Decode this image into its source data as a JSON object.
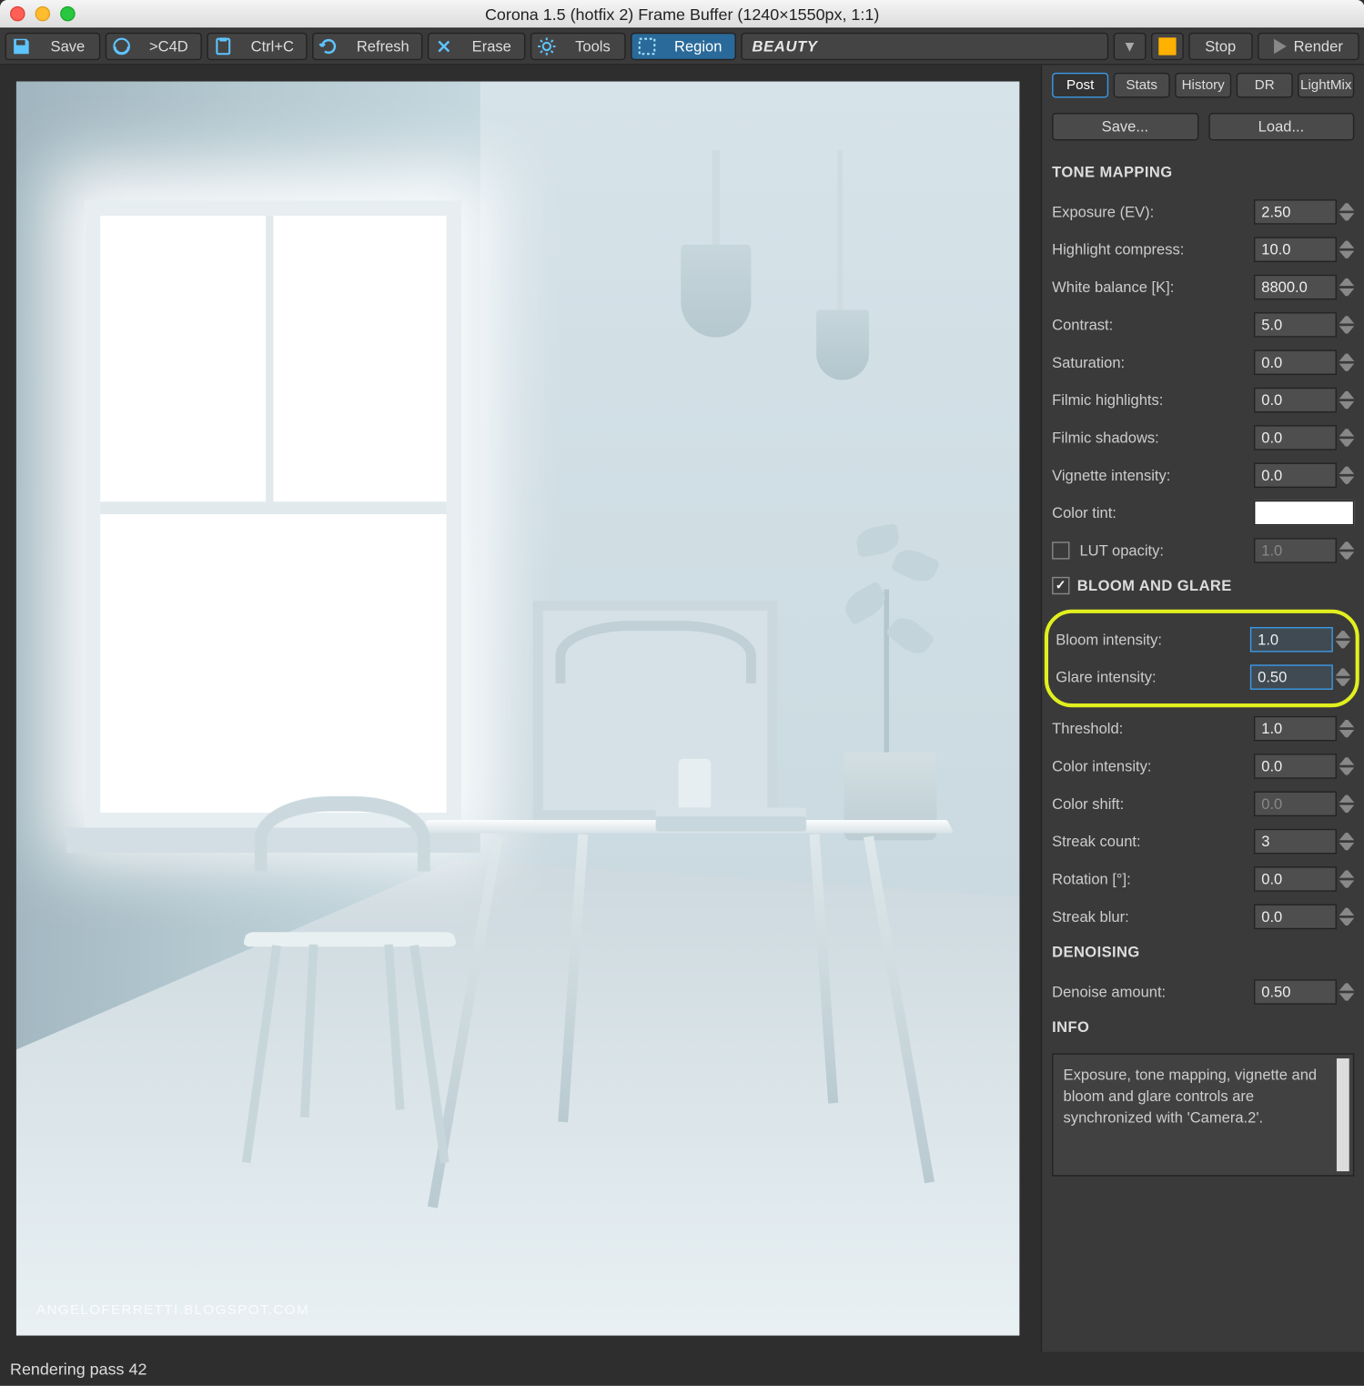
{
  "title": "Corona 1.5 (hotfix 2) Frame Buffer (1240×1550px, 1:1)",
  "toolbar": {
    "save": "Save",
    "c4d": ">C4D",
    "ctrlc": "Ctrl+C",
    "refresh": "Refresh",
    "erase": "Erase",
    "tools": "Tools",
    "region": "Region",
    "pass": "BEAUTY",
    "stop": "Stop",
    "render": "Render"
  },
  "tabs": [
    "Post",
    "Stats",
    "History",
    "DR",
    "LightMix"
  ],
  "active_tab": 0,
  "post": {
    "save_btn": "Save...",
    "load_btn": "Load...",
    "sections": {
      "tone": "TONE MAPPING",
      "bloom": "BLOOM AND GLARE",
      "denoise": "DENOISING",
      "info": "INFO"
    },
    "tone": {
      "exposure": {
        "label": "Exposure (EV):",
        "value": "2.50"
      },
      "highlight": {
        "label": "Highlight compress:",
        "value": "10.0"
      },
      "whitebal": {
        "label": "White balance [K]:",
        "value": "8800.0"
      },
      "contrast": {
        "label": "Contrast:",
        "value": "5.0"
      },
      "saturation": {
        "label": "Saturation:",
        "value": "0.0"
      },
      "filmic_hi": {
        "label": "Filmic highlights:",
        "value": "0.0"
      },
      "filmic_sh": {
        "label": "Filmic shadows:",
        "value": "0.0"
      },
      "vignette": {
        "label": "Vignette intensity:",
        "value": "0.0"
      },
      "tint": {
        "label": "Color tint:",
        "value": "#ffffff"
      },
      "lut": {
        "label": "LUT opacity:",
        "value": "1.0",
        "checked": false
      }
    },
    "bloom_checked": true,
    "bloom": {
      "bloom_int": {
        "label": "Bloom intensity:",
        "value": "1.0"
      },
      "glare_int": {
        "label": "Glare intensity:",
        "value": "0.50"
      },
      "threshold": {
        "label": "Threshold:",
        "value": "1.0"
      },
      "color_int": {
        "label": "Color intensity:",
        "value": "0.0"
      },
      "color_shift": {
        "label": "Color shift:",
        "value": "0.0",
        "disabled": true
      },
      "streak": {
        "label": "Streak count:",
        "value": "3"
      },
      "rotation": {
        "label": "Rotation [°]:",
        "value": "0.0"
      },
      "streak_blur": {
        "label": "Streak blur:",
        "value": "0.0"
      }
    },
    "denoise": {
      "label": "Denoise amount:",
      "value": "0.50"
    },
    "info_text": "Exposure, tone mapping, vignette and bloom and glare controls are synchronized with 'Camera.2'."
  },
  "watermark": "ANGELOFERRETTI.BLOGSPOT.COM",
  "status": "Rendering pass 42"
}
